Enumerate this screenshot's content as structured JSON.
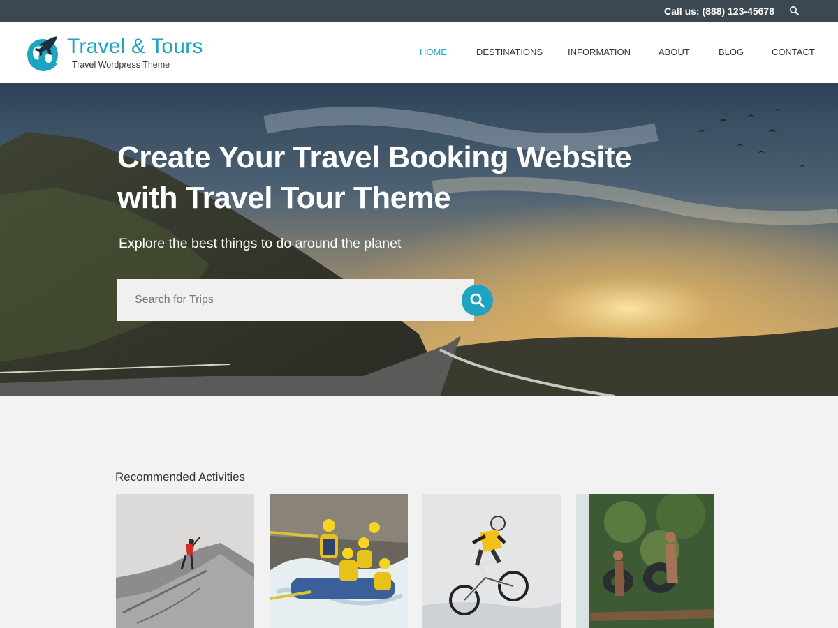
{
  "topbar": {
    "phone": "Call us: (888) 123-45678",
    "search_icon": "search-icon"
  },
  "header": {
    "logo_title": "Travel & Tours",
    "logo_tagline": "Travel Wordpress Theme",
    "nav": [
      {
        "label": "HOME",
        "active": true
      },
      {
        "label": "DESTINATIONS",
        "active": false
      },
      {
        "label": "INFORMATION",
        "active": false
      },
      {
        "label": "ABOUT",
        "active": false
      },
      {
        "label": "BLOG",
        "active": false
      },
      {
        "label": "CONTACT",
        "active": false
      }
    ]
  },
  "hero": {
    "title_line1": "Create Your Travel Booking Website",
    "title_line2": "with Travel Tour Theme",
    "subtitle": "Explore the best things to do around the planet",
    "search_placeholder": "Search for Trips"
  },
  "activities": {
    "title": "Recommended Activities",
    "items": [
      {
        "image": "mountain-climber"
      },
      {
        "image": "white-water-rafting"
      },
      {
        "image": "mountain-biking"
      },
      {
        "image": "river-tubing"
      }
    ]
  },
  "colors": {
    "accent": "#1ea3c3",
    "topbar": "#3b4852",
    "page_bg": "#f2f2f2"
  }
}
